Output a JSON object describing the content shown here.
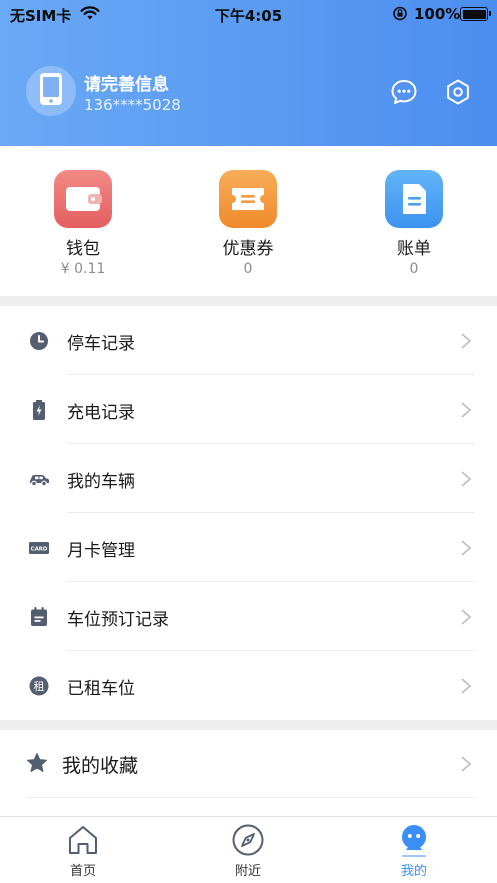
{
  "status_bar": {
    "carrier": "无SIM卡",
    "time": "下午4:05",
    "battery": "100%"
  },
  "profile": {
    "name": "请完善信息",
    "phone": "136****5028"
  },
  "quick": [
    {
      "label": "钱包",
      "value": "¥ 0.11",
      "icon": "wallet-icon",
      "color": "#ec6c6c"
    },
    {
      "label": "优惠券",
      "value": "0",
      "icon": "coupon-icon",
      "color": "#f59a3e"
    },
    {
      "label": "账单",
      "value": "0",
      "icon": "bill-icon",
      "color": "#4a9ff0"
    }
  ],
  "menu": [
    {
      "label": "停车记录",
      "icon": "clock-icon"
    },
    {
      "label": "充电记录",
      "icon": "battery-icon"
    },
    {
      "label": "我的车辆",
      "icon": "car-icon"
    },
    {
      "label": "月卡管理",
      "icon": "card-icon",
      "icon_text": "CARD"
    },
    {
      "label": "车位预订记录",
      "icon": "calendar-icon"
    },
    {
      "label": "已租车位",
      "icon": "rent-icon",
      "icon_text": "租"
    }
  ],
  "favorites": {
    "label": "我的收藏",
    "icon": "star-icon"
  },
  "tabs": [
    {
      "label": "首页",
      "icon": "home-icon"
    },
    {
      "label": "附近",
      "icon": "compass-icon"
    },
    {
      "label": "我的",
      "icon": "profile-icon",
      "active": true
    }
  ],
  "colors": {
    "header_start": "#6aa9f5",
    "header_end": "#4c8ef0",
    "accent": "#3a8ef6",
    "menu_icon": "#555e70"
  }
}
